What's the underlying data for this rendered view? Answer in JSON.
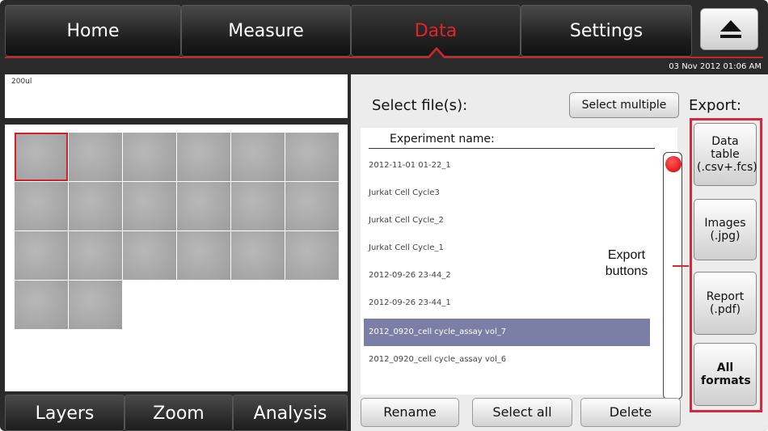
{
  "nav": {
    "tabs": [
      {
        "label": "Home"
      },
      {
        "label": "Measure"
      },
      {
        "label": "Data",
        "active": true
      },
      {
        "label": "Settings"
      }
    ],
    "eject_icon": "eject-icon",
    "active_color": "#e0242a"
  },
  "datetime": "03 Nov 2012  01:06 AM",
  "left_panel": {
    "sample_label": "200ul",
    "thumbnail_count": 20,
    "tabs": [
      "Layers",
      "Zoom",
      "Analysis"
    ]
  },
  "right_panel": {
    "select_title": "Select file(s):",
    "select_multiple": "Select multiple",
    "export_title": "Export:",
    "list_header": "Experiment name:",
    "files": [
      "2012-11-01 01-22_1",
      "Jurkat Cell Cycle3",
      "Jurkat Cell Cycle_2",
      "Jurkat Cell Cycle_1",
      "2012-09-26 23-44_2",
      "2012-09-26 23-44_1",
      "2012_0920_cell cycle_assay vol_7",
      "2012_0920_cell cycle_assay vol_6"
    ],
    "selected_file": "2012_0920_cell cycle_assay vol_7",
    "buttons": {
      "rename": "Rename",
      "select_all": "Select all",
      "delete": "Delete"
    },
    "export_buttons": {
      "data_table": "Data table (.csv+.fcs)",
      "images": "Images (.jpg)",
      "report": "Report (.pdf)",
      "all": "All formats"
    }
  },
  "annotation": {
    "text": "Export buttons",
    "color": "#d6283a"
  }
}
